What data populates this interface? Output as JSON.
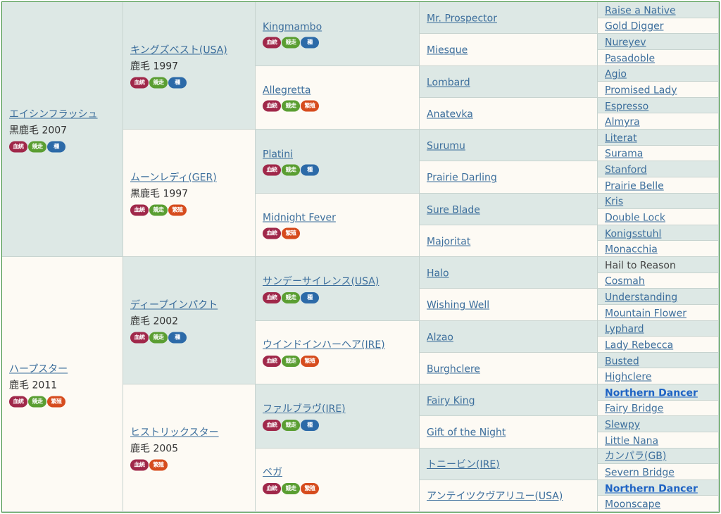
{
  "horses": {
    "g1": [
      {
        "name": "エイシンフラッシュ",
        "info": "黒鹿毛 2007",
        "icons": [
          "blood",
          "race",
          "seed"
        ]
      },
      {
        "name": "ハープスター",
        "info": "鹿毛 2011",
        "icons": [
          "blood",
          "race",
          "sib"
        ]
      }
    ],
    "g2": [
      {
        "name": "キングズベスト(USA)",
        "info": "鹿毛 1997",
        "icons": [
          "blood",
          "race",
          "seed"
        ]
      },
      {
        "name": "ムーンレディ(GER)",
        "info": "黒鹿毛 1997",
        "icons": [
          "blood",
          "race",
          "sib"
        ]
      },
      {
        "name": "ディープインパクト",
        "info": "鹿毛 2002",
        "icons": [
          "blood",
          "race",
          "seed"
        ]
      },
      {
        "name": "ヒストリックスター",
        "info": "鹿毛 2005",
        "icons": [
          "blood",
          "sib"
        ]
      }
    ],
    "g3": [
      {
        "name": "Kingmambo",
        "icons": [
          "blood",
          "race",
          "seed"
        ]
      },
      {
        "name": "Allegretta",
        "icons": [
          "blood",
          "race",
          "sib"
        ]
      },
      {
        "name": "Platini",
        "icons": [
          "blood",
          "race",
          "seed"
        ]
      },
      {
        "name": "Midnight Fever",
        "icons": [
          "blood",
          "sib"
        ]
      },
      {
        "name": "サンデーサイレンス(USA)",
        "icons": [
          "blood",
          "race",
          "seed"
        ]
      },
      {
        "name": "ウインドインハーヘア(IRE)",
        "icons": [
          "blood",
          "race",
          "sib"
        ]
      },
      {
        "name": "ファルブラヴ(IRE)",
        "icons": [
          "blood",
          "race",
          "seed"
        ]
      },
      {
        "name": "ベガ",
        "icons": [
          "blood",
          "race",
          "sib"
        ]
      }
    ],
    "g4": [
      "Mr. Prospector",
      "Miesque",
      "Lombard",
      "Anatevka",
      "Surumu",
      "Prairie Darling",
      "Sure Blade",
      "Majoritat",
      "Halo",
      "Wishing Well",
      "Alzao",
      "Burghclere",
      "Fairy King",
      "Gift of the Night",
      "トニービン(IRE)",
      "アンテイツクヴアリユー(USA)"
    ],
    "g5": [
      "Raise a Native",
      "Gold Digger",
      "Nureyev",
      "Pasadoble",
      "Agio",
      "Promised Lady",
      "Espresso",
      "Almyra",
      "Literat",
      "Surama",
      "Stanford",
      "Prairie Belle",
      "Kris",
      "Double Lock",
      "Konigsstuhl",
      "Monacchia",
      "Hail to Reason",
      "Cosmah",
      "Understanding",
      "Mountain Flower",
      "Lyphard",
      "Lady Rebecca",
      "Busted",
      "Highclere",
      "Northern Dancer",
      "Fairy Bridge",
      "Slewpy",
      "Little Nana",
      "カンパラ(GB)",
      "Severn Bridge",
      "Northern Dancer",
      "Moonscape"
    ],
    "g5_bold": [
      24,
      30
    ],
    "g5_nolink": [
      16
    ]
  },
  "icon_labels": {
    "blood": "血統",
    "race": "競走",
    "seed": "種",
    "sib": "繁殖"
  }
}
